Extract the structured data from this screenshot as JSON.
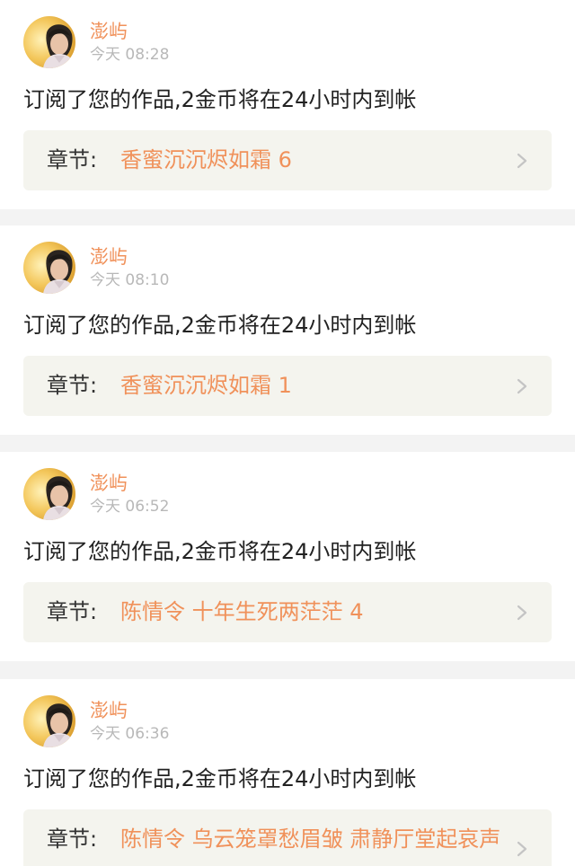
{
  "feed": [
    {
      "user": "澎屿",
      "time": "今天 08:28",
      "message": "订阅了您的作品,2金币将在24小时内到帐",
      "chapter_label": "章节:",
      "chapter_title": "香蜜沉沉烬如霜 6"
    },
    {
      "user": "澎屿",
      "time": "今天 08:10",
      "message": "订阅了您的作品,2金币将在24小时内到帐",
      "chapter_label": "章节:",
      "chapter_title": "香蜜沉沉烬如霜 1"
    },
    {
      "user": "澎屿",
      "time": "今天 06:52",
      "message": "订阅了您的作品,2金币将在24小时内到帐",
      "chapter_label": "章节:",
      "chapter_title": "陈情令 十年生死两茫茫 4"
    },
    {
      "user": "澎屿",
      "time": "今天 06:36",
      "message": "订阅了您的作品,2金币将在24小时内到帐",
      "chapter_label": "章节:",
      "chapter_title": "陈情令 乌云笼罩愁眉皱 肃静厅堂起哀声"
    }
  ],
  "icons": {
    "avatar": "user-avatar-photo",
    "chevron": "chevron-right-icon"
  },
  "colors": {
    "accent": "#f0915a",
    "timestamp": "#b8b8b8",
    "chapter_box_bg": "#f4f4ee",
    "page_bg": "#f3f3f3"
  }
}
